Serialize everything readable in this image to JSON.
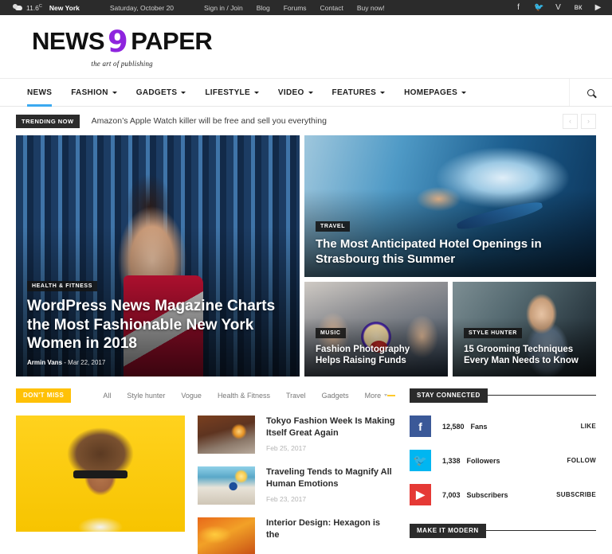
{
  "topbar": {
    "weather_icon": "cloud-icon",
    "temperature": "11.6",
    "temp_unit": "C",
    "city": "New York",
    "date": "Saturday, October 20",
    "links": [
      "Sign in / Join",
      "Blog",
      "Forums",
      "Contact",
      "Buy now!"
    ],
    "social": [
      {
        "name": "facebook-icon",
        "glyph": "f"
      },
      {
        "name": "twitter-icon",
        "glyph": "🐦"
      },
      {
        "name": "vimeo-icon",
        "glyph": "V"
      },
      {
        "name": "vk-icon",
        "glyph": "вк"
      },
      {
        "name": "youtube-icon",
        "glyph": "▶"
      }
    ]
  },
  "logo": {
    "part1": "NEWS",
    "accent": "9",
    "part2": "PAPER",
    "tagline": "the art of publishing",
    "accent_color": "#8e24de"
  },
  "nav": {
    "items": [
      {
        "label": "NEWS",
        "has_caret": false,
        "active": true
      },
      {
        "label": "FASHION",
        "has_caret": true,
        "active": false
      },
      {
        "label": "GADGETS",
        "has_caret": true,
        "active": false
      },
      {
        "label": "LIFESTYLE",
        "has_caret": true,
        "active": false
      },
      {
        "label": "VIDEO",
        "has_caret": true,
        "active": false
      },
      {
        "label": "FEATURES",
        "has_caret": true,
        "active": false
      },
      {
        "label": "HOMEPAGES",
        "has_caret": true,
        "active": false
      }
    ],
    "search_icon": "search-icon",
    "active_color": "#3ba9f0"
  },
  "trending": {
    "badge": "TRENDING NOW",
    "headline": "Amazon’s Apple Watch killer will be free and sell you everything",
    "prev": "‹",
    "next": "›"
  },
  "hero": {
    "main": {
      "category": "HEALTH & FITNESS",
      "title": "WordPress News Magazine Charts the Most Fashionable New York Women in 2018",
      "author": "Armin Vans",
      "separator": "-",
      "date": "Mar 22, 2017"
    },
    "top": {
      "category": "TRAVEL",
      "title": "The Most Anticipated Hotel Openings in Strasbourg this Summer"
    },
    "small": [
      {
        "category": "MUSIC",
        "title": "Fashion Photography Helps Raising Funds"
      },
      {
        "category": "STYLE HUNTER",
        "title": "15 Grooming Techniques Every Man Needs to Know"
      }
    ]
  },
  "dont_miss": {
    "badge": "DON'T MISS",
    "badge_color": "#ffc107",
    "filters": [
      "All",
      "Style hunter",
      "Vogue",
      "Health & Fitness",
      "Travel",
      "Gadgets"
    ],
    "more_label": "More",
    "items": [
      {
        "title": "Tokyo Fashion Week Is Making Itself Great Again",
        "date": "Feb 25, 2017"
      },
      {
        "title": "Traveling Tends to Magnify All Human Emotions",
        "date": "Feb 23, 2017"
      },
      {
        "title": "Interior Design: Hexagon is the",
        "date": ""
      }
    ]
  },
  "sidebar": {
    "stay_connected": {
      "badge": "STAY CONNECTED",
      "rows": [
        {
          "icon": "facebook-icon",
          "glyph": "f",
          "count": "12,580",
          "label": "Fans",
          "action": "LIKE",
          "color": "#3b5998"
        },
        {
          "icon": "twitter-icon",
          "glyph": "🐦",
          "count": "1,338",
          "label": "Followers",
          "action": "FOLLOW",
          "color": "#00b6f1"
        },
        {
          "icon": "youtube-icon",
          "glyph": "▶",
          "count": "7,003",
          "label": "Subscribers",
          "action": "SUBSCRIBE",
          "color": "#e53935"
        }
      ]
    },
    "make_it_modern": {
      "badge": "MAKE IT MODERN"
    }
  }
}
